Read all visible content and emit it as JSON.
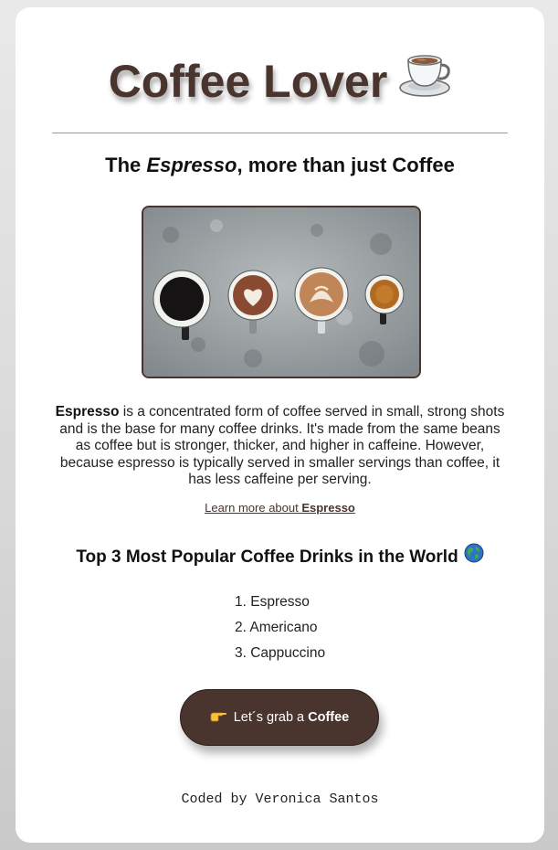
{
  "header": {
    "title": "Coffee Lover",
    "title_icon": "coffee-cup-icon"
  },
  "intro": {
    "heading_prefix": "The ",
    "heading_emphasis": "Espresso",
    "heading_suffix": ", more than just Coffee"
  },
  "photo": {
    "alt": "four cups of coffee on a concrete table"
  },
  "description": {
    "lead": "Espresso",
    "text": " is a concentrated form of coffee served in small, strong shots and is the base for many coffee drinks. It's made from the same beans as coffee but is stronger, thicker, and higher in caffeine. However, because espresso is typically served in smaller servings than coffee, it has less caffeine per serving."
  },
  "learn_more": {
    "prefix": "Learn more about ",
    "bold": "Espresso"
  },
  "popular": {
    "heading": "Top 3 Most Popular Coffee Drinks in the World",
    "heading_icon": "globe-icon",
    "items": [
      {
        "num": "1. ",
        "label": "Espresso"
      },
      {
        "num": "2. ",
        "label": "Americano"
      },
      {
        "num": "3. ",
        "label": "Cappuccino"
      }
    ]
  },
  "cta": {
    "icon": "pointing-hand-icon",
    "prefix": "Let´s grab a",
    "bold": "Coffee"
  },
  "footer": {
    "credit": "Coded by Veronica Santos"
  },
  "colors": {
    "brand": "#4a342e",
    "background": "#ffffff"
  }
}
